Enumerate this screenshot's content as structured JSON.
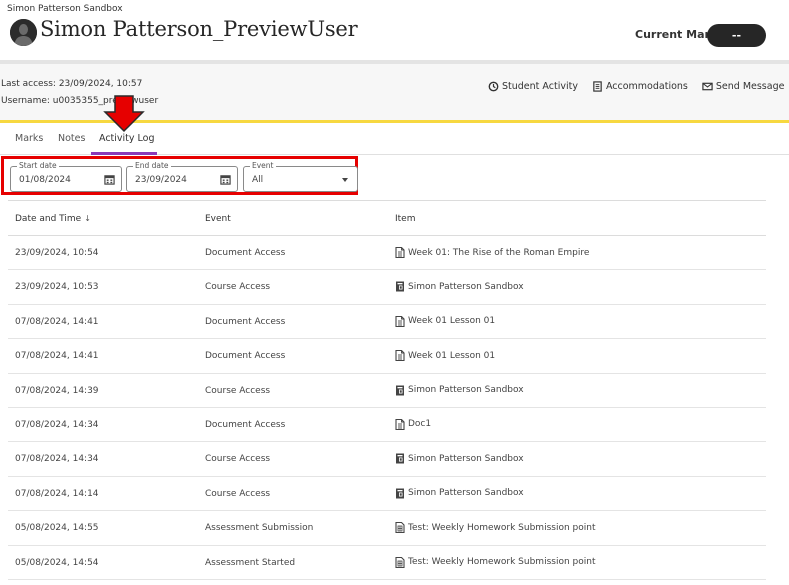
{
  "header": {
    "course_name": "Simon Patterson Sandbox",
    "user_name": "Simon Patterson_PreviewUser",
    "current_mark_label": "Current Mark",
    "current_mark_value": "--"
  },
  "info": {
    "last_access": "Last access: 23/09/2024, 10:57",
    "username": "Username: u0035355_previewuser"
  },
  "actions": [
    {
      "label": "Student Activity",
      "icon": "clock-icon"
    },
    {
      "label": "Accommodations",
      "icon": "document-list-icon"
    },
    {
      "label": "Send Message",
      "icon": "envelope-icon"
    }
  ],
  "tabs": [
    {
      "label": "Marks",
      "active": false
    },
    {
      "label": "Notes",
      "active": false
    },
    {
      "label": "Activity Log",
      "active": true
    }
  ],
  "filters": {
    "start_date": {
      "label": "Start date",
      "value": "01/08/2024"
    },
    "end_date": {
      "label": "End date",
      "value": "23/09/2024"
    },
    "event": {
      "label": "Event",
      "value": "All"
    }
  },
  "table": {
    "headers": [
      "Date and Time",
      "Event",
      "Item"
    ],
    "sort_indicator": "↓",
    "rows": [
      {
        "date": "23/09/2024, 10:54",
        "event": "Document Access",
        "item": "Week 01: The Rise of the Roman Empire",
        "icon": "document-icon"
      },
      {
        "date": "23/09/2024, 10:53",
        "event": "Course Access",
        "item": "Simon Patterson Sandbox",
        "icon": "course-icon"
      },
      {
        "date": "07/08/2024, 14:41",
        "event": "Document Access",
        "item": "Week 01 Lesson 01",
        "icon": "document-icon"
      },
      {
        "date": "07/08/2024, 14:41",
        "event": "Document Access",
        "item": "Week 01 Lesson 01",
        "icon": "document-icon"
      },
      {
        "date": "07/08/2024, 14:39",
        "event": "Course Access",
        "item": "Simon Patterson Sandbox",
        "icon": "course-icon"
      },
      {
        "date": "07/08/2024, 14:34",
        "event": "Document Access",
        "item": "Doc1",
        "icon": "document-icon"
      },
      {
        "date": "07/08/2024, 14:34",
        "event": "Course Access",
        "item": "Simon Patterson Sandbox",
        "icon": "course-icon"
      },
      {
        "date": "07/08/2024, 14:14",
        "event": "Course Access",
        "item": "Simon Patterson Sandbox",
        "icon": "course-icon"
      },
      {
        "date": "05/08/2024, 14:55",
        "event": "Assessment Submission",
        "item": "Test: Weekly Homework Submission point",
        "icon": "test-icon"
      },
      {
        "date": "05/08/2024, 14:54",
        "event": "Assessment Started",
        "item": "Test: Weekly Homework Submission point",
        "icon": "test-icon"
      }
    ]
  },
  "annotations": {
    "arrow_color": "#e60000",
    "highlight_box_color": "#e60000"
  },
  "colors": {
    "tab_active_underline": "#8a3ab9",
    "accent_yellow": "#f7d840"
  }
}
